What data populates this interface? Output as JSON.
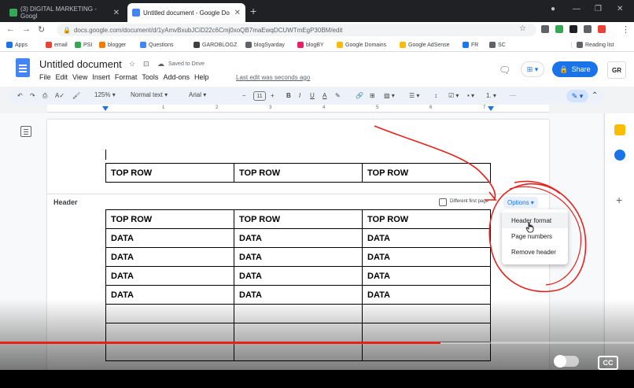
{
  "browser": {
    "tabs": [
      {
        "title": "(3) DIGITAL MARKETING - Googl",
        "active": false
      },
      {
        "title": "Untitled document - Google Do",
        "active": true
      }
    ],
    "url": "docs.google.com/document/d/1yAmvBxubJCiD22c6Cmj0xoQB7maEwqDCUWTmEgP30BM/edit",
    "bookmarks": [
      "Apps",
      "email",
      "PSI",
      "blogger",
      "Questions",
      "GAROBLOGZ",
      "blogSyarday",
      "blogBY",
      "Google Domains",
      "Google AdSense",
      "FR",
      "SC"
    ],
    "reading_list": "Reading list"
  },
  "docs": {
    "title": "Untitled document",
    "saved_status": "Saved to Drive",
    "menu": [
      "File",
      "Edit",
      "View",
      "Insert",
      "Format",
      "Tools",
      "Add-ons",
      "Help"
    ],
    "last_edit": "Last edit was seconds ago",
    "share_label": "Share",
    "avatar_initials": "GR"
  },
  "toolbar": {
    "zoom": "125%",
    "style": "Normal text",
    "font": "Arial",
    "font_size": "11",
    "more": "···"
  },
  "ruler": [
    "1",
    "2",
    "3",
    "4",
    "5",
    "6",
    "7"
  ],
  "top_table": {
    "rows": [
      [
        "TOP ROW",
        "TOP ROW",
        "TOP ROW"
      ]
    ]
  },
  "header": {
    "label": "Header",
    "different_first_page": "Different first page",
    "options_label": "Options ▾"
  },
  "main_table": {
    "rows": [
      [
        "TOP ROW",
        "TOP ROW",
        "TOP ROW"
      ],
      [
        "DATA",
        "DATA",
        "DATA"
      ],
      [
        "DATA",
        "DATA",
        "DATA"
      ],
      [
        "DATA",
        "DATA",
        "DATA"
      ],
      [
        "DATA",
        "DATA",
        "DATA"
      ],
      [
        "",
        "",
        ""
      ],
      [
        "",
        "",
        ""
      ],
      [
        "",
        "",
        ""
      ]
    ]
  },
  "options_menu": [
    "Header format",
    "Page numbers",
    "Remove header"
  ],
  "video": {
    "progress": 0.695,
    "cc_label": "CC"
  },
  "colors": {
    "accent": "#1a73e8",
    "annotation": "#e8201c",
    "progress": "#e62117"
  }
}
